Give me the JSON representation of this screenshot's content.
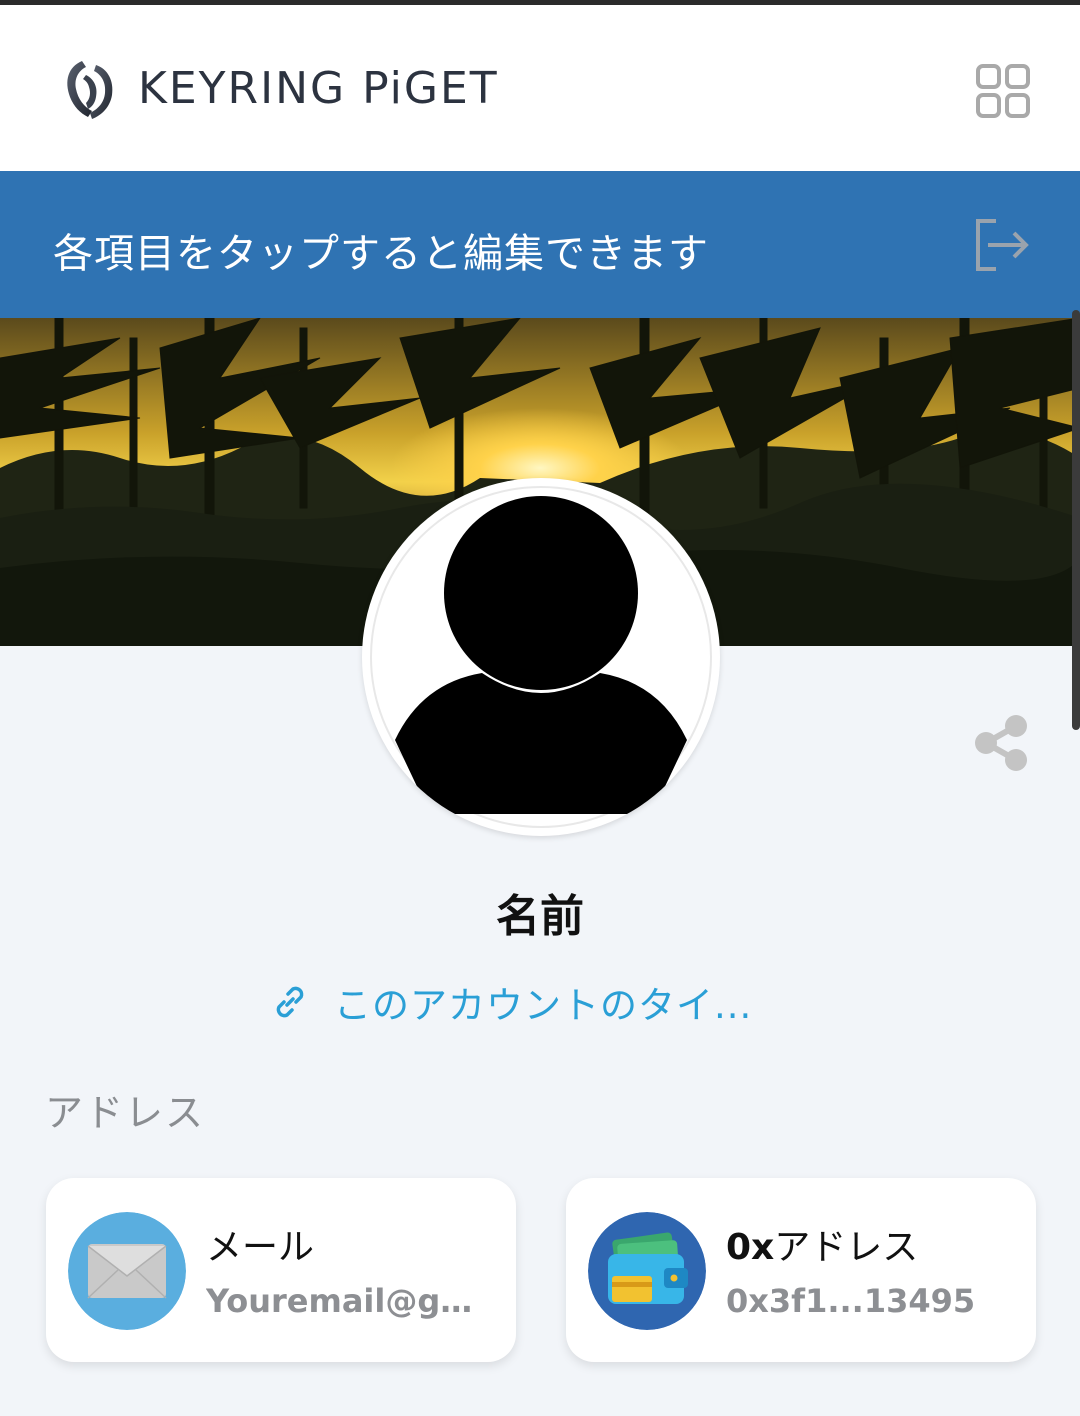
{
  "header": {
    "brand": "KEYRING PiGET",
    "logo_icon": "keyring-logo-icon",
    "menu_icon": "grid-menu-icon"
  },
  "banner": {
    "text": "各項目をタップすると編集できます",
    "logout_icon": "logout-icon",
    "background_color": "#2f73b3"
  },
  "profile": {
    "name": "名前",
    "tagline": "このアカウントのタイ...",
    "avatar_icon": "user-avatar-icon",
    "share_icon": "share-icon",
    "link_icon": "link-icon",
    "accent_color": "#2a9fd6"
  },
  "address_section": {
    "label": "アドレス",
    "cards": [
      {
        "icon": "mail-icon",
        "title": "メール",
        "value": "Youremail@gma..."
      },
      {
        "icon": "wallet-icon",
        "title_prefix": "0x",
        "title_rest": "アドレス",
        "value": "0x3f1...13495"
      }
    ]
  }
}
